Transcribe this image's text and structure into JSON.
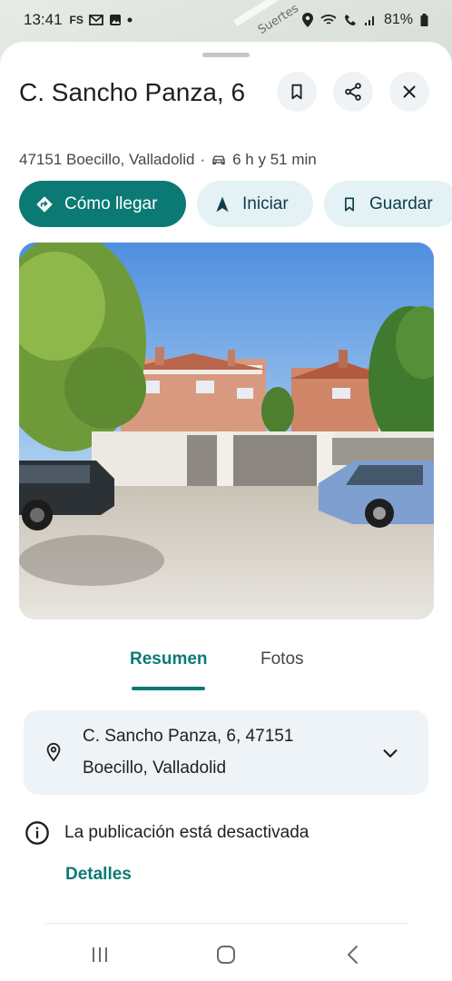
{
  "status_bar": {
    "time": "13:41",
    "left_icons": [
      "FS",
      "gmail-icon",
      "gallery-icon",
      "dot-icon"
    ],
    "battery": "81%"
  },
  "map": {
    "street_label": "Suertes"
  },
  "place": {
    "title": "C. Sancho Panza, 6",
    "subtitle_location": "47151 Boecillo, Valladolid",
    "subtitle_separator": "·",
    "travel_time": "6 h y 51 min",
    "travel_mode_icon": "car-icon"
  },
  "header_buttons": {
    "save_icon": "bookmark-icon",
    "share_icon": "share-icon",
    "close_icon": "close-icon"
  },
  "actions": {
    "directions": "Cómo llegar",
    "start": "Iniciar",
    "save": "Guardar"
  },
  "tabs": {
    "overview": "Resumen",
    "photos": "Fotos",
    "active": "overview"
  },
  "address_card": {
    "line1": "C. Sancho Panza, 6, 47151",
    "line2": "Boecillo, Valladolid"
  },
  "notice": {
    "text": "La publicación está desactivada",
    "link": "Detalles"
  },
  "colors": {
    "accent": "#0b7a75",
    "secondary_pill": "#e4f2f5",
    "card_bg": "#eef3f7"
  }
}
